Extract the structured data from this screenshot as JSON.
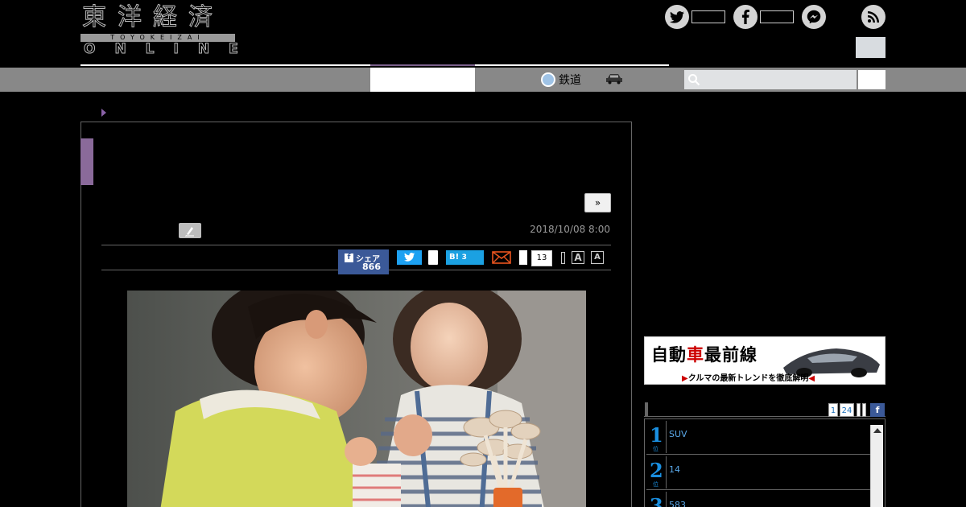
{
  "header": {
    "logo_kanji": "東洋経済",
    "logo_bar": "TOYOKEIZAI",
    "logo_online": "ONLINE"
  },
  "nav": {
    "rail_label": "鉄道"
  },
  "article": {
    "date": "2018/10/08 8:00",
    "next_label": "»",
    "share": {
      "facebook_label": "シェア",
      "facebook_count": "866",
      "hatena_label": "B!",
      "hatena_count": "3",
      "pocket_count": "13"
    },
    "font_large": "A",
    "font_small": "A"
  },
  "sidebar": {
    "banner_title_a": "自動",
    "banner_title_b": "車",
    "banner_title_c": "最前線",
    "banner_sub": "クルマの最新トレンドを徹底解明",
    "ranking_tabs": [
      "1",
      "24"
    ],
    "ranking_fb": "f",
    "rank_suffix": "位",
    "ranking": [
      {
        "rank": "1",
        "text": "SUV"
      },
      {
        "rank": "2",
        "text": "14"
      },
      {
        "rank": "3",
        "text": "583"
      }
    ]
  },
  "colors": {
    "accent_purple": "#8a62a8",
    "facebook": "#3b5998",
    "twitter": "#1da1f2",
    "hatena": "#1ba1e2",
    "rank_blue": "#1a8fe0"
  }
}
